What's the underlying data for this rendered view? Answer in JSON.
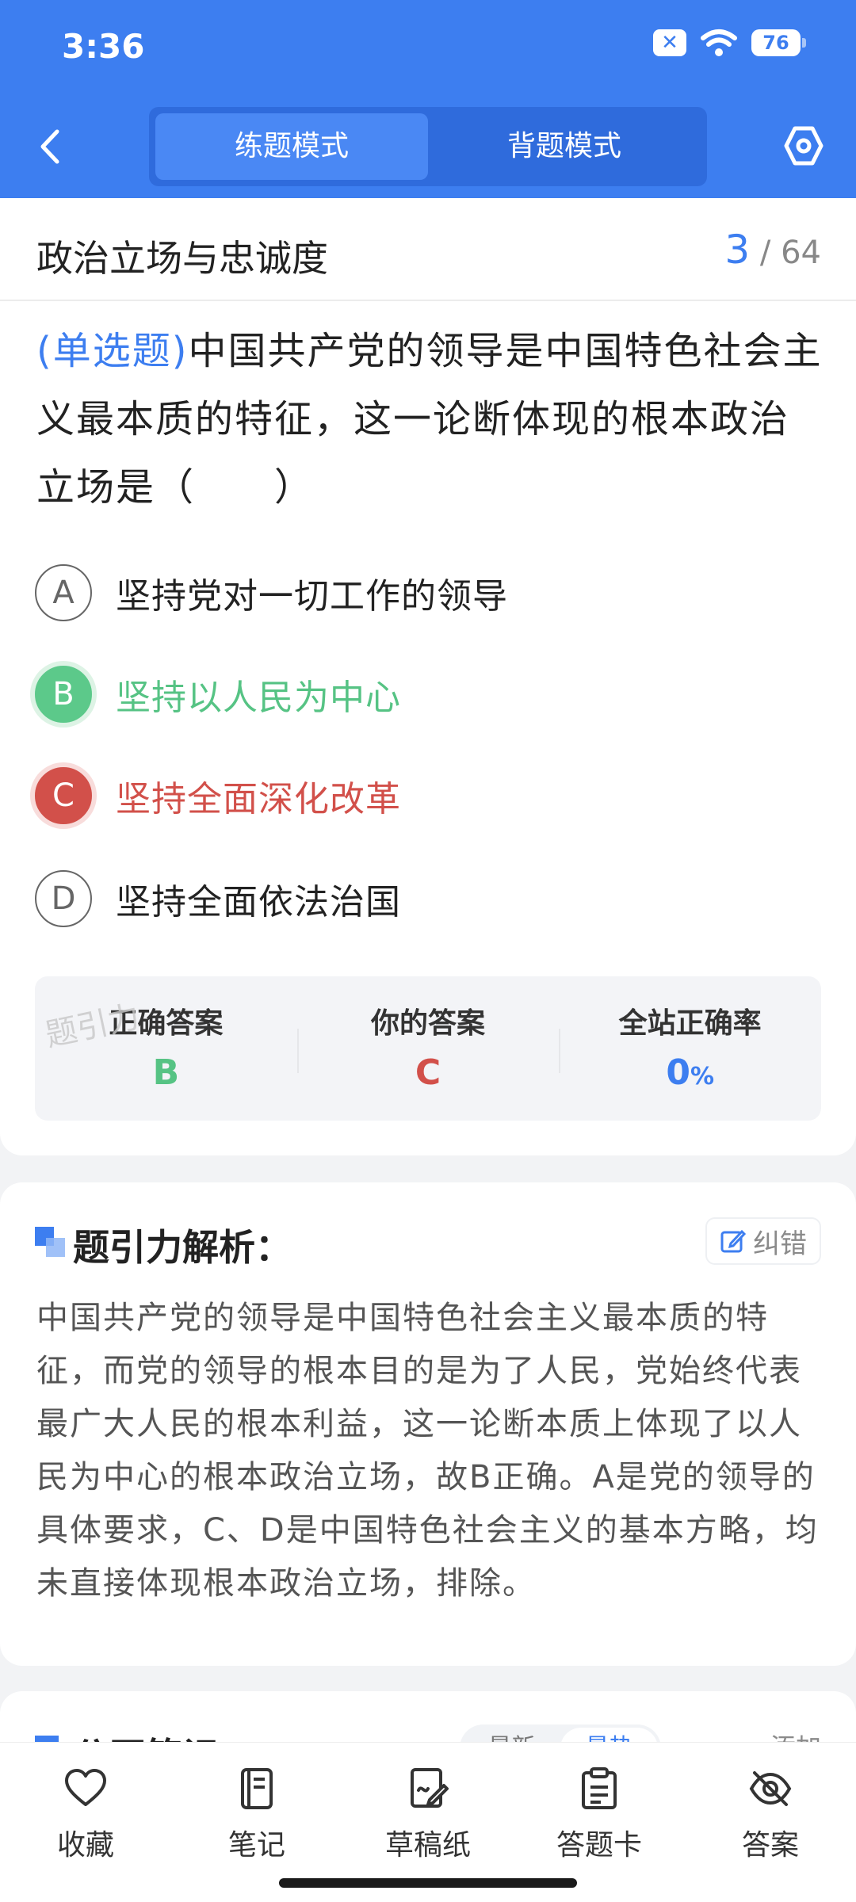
{
  "status_bar": {
    "time": "3:36",
    "battery": "76"
  },
  "header": {
    "modes": [
      "练题模式",
      "背题模式"
    ]
  },
  "question": {
    "subject": "政治立场与忠诚度",
    "current": "3",
    "total": "/ 64",
    "type_label": "(单选题)",
    "text": "中国共产党的领导是中国特色社会主义最本质的特征，这一论断体现的根本政治立场是（　　）",
    "options": [
      {
        "letter": "A",
        "text": "坚持党对一切工作的领导"
      },
      {
        "letter": "B",
        "text": "坚持以人民为中心"
      },
      {
        "letter": "C",
        "text": "坚持全面深化改革"
      },
      {
        "letter": "D",
        "text": "坚持全面依法治国"
      }
    ]
  },
  "result": {
    "watermark": "题引力",
    "correct_label": "正确答案",
    "correct_value": "B",
    "yours_label": "你的答案",
    "yours_value": "C",
    "rate_label": "全站正确率",
    "rate_value": "0",
    "rate_unit": "%",
    "colors": {
      "correct": "#56c384",
      "wrong": "#d2504a",
      "accent": "#3d7ef0"
    }
  },
  "analysis": {
    "title": "题引力解析：",
    "fix_label": "纠错",
    "text": "中国共产党的领导是中国特色社会主义最本质的特征，而党的领导的根本目的是为了人民，党始终代表最广大人民的根本利益，这一论断本质上体现了以人民为中心的根本政治立场，故B正确。A是党的领导的具体要求，C、D是中国特色社会主义的基本方略，均未直接体现根本政治立场，排除。"
  },
  "notes": {
    "title": "公开笔记：",
    "sort_options": [
      "最新",
      "最热"
    ],
    "add_label": "添加"
  },
  "bottom_nav": [
    {
      "label": "收藏",
      "icon": "heart-icon"
    },
    {
      "label": "笔记",
      "icon": "notebook-icon"
    },
    {
      "label": "草稿纸",
      "icon": "draft-icon"
    },
    {
      "label": "答题卡",
      "icon": "clipboard-icon"
    },
    {
      "label": "答案",
      "icon": "eye-off-icon"
    }
  ]
}
